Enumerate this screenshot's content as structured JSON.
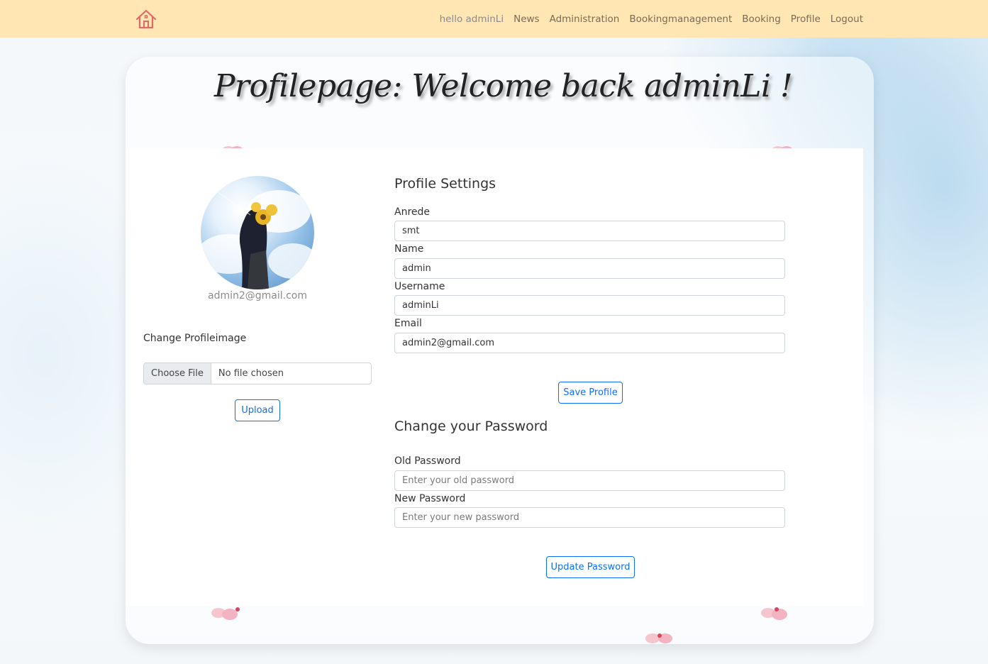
{
  "nav": {
    "greeting": "hello adminLi",
    "links": [
      "News",
      "Administration",
      "Bookingmanagement",
      "Booking",
      "Profile",
      "Logout"
    ]
  },
  "page": {
    "title": "Profilepage: Welcome back adminLi !"
  },
  "avatar": {
    "email": "admin2@gmail.com"
  },
  "profile_image": {
    "label": "Change Profileimage",
    "choose_button": "Choose File",
    "file_status": "No file chosen",
    "upload_button": "Upload"
  },
  "profile_settings": {
    "title": "Profile Settings",
    "fields": [
      {
        "label": "Anrede",
        "value": "smt"
      },
      {
        "label": "Name",
        "value": "admin"
      },
      {
        "label": "Username",
        "value": "adminLi"
      },
      {
        "label": "Email",
        "value": "admin2@gmail.com"
      }
    ],
    "save_button": "Save Profile"
  },
  "password": {
    "title": "Change your Password",
    "old_label": "Old Password",
    "old_placeholder": "Enter your old password",
    "new_label": "New Password",
    "new_placeholder": "Enter your new password",
    "update_button": "Update Password"
  },
  "colors": {
    "navbar": "#ffe6b3",
    "accent": "#0d6efd"
  }
}
